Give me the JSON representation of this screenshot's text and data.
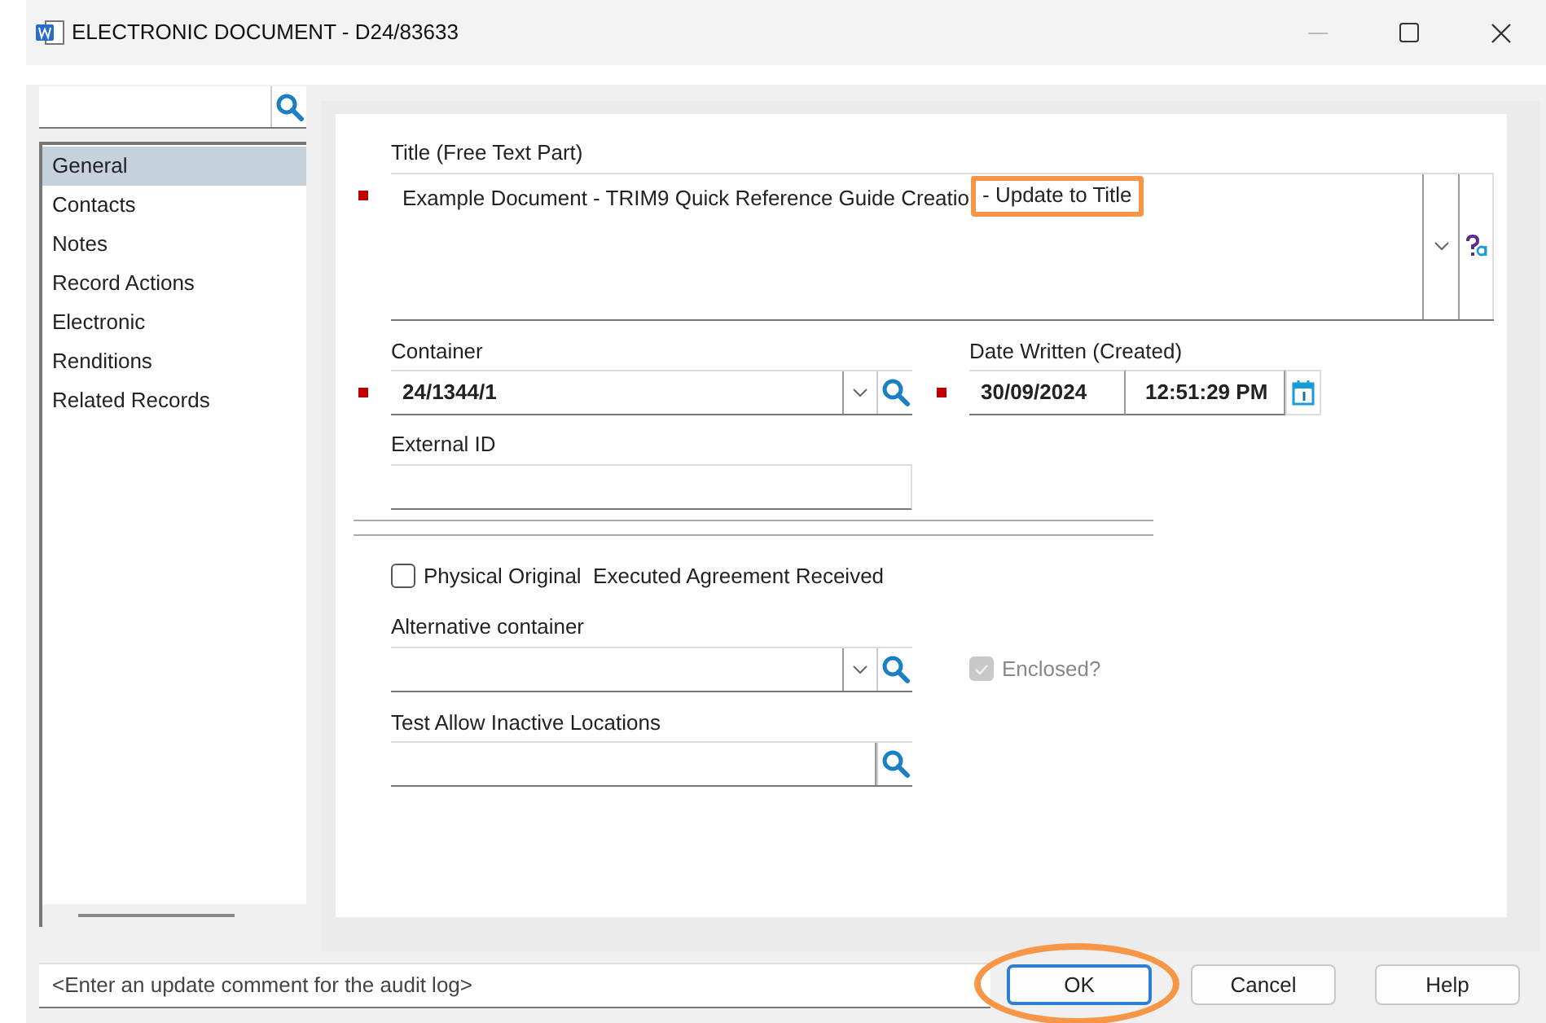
{
  "window": {
    "title": "ELECTRONIC DOCUMENT - D24/83633"
  },
  "sidebar": {
    "items": [
      {
        "label": "General",
        "selected": true
      },
      {
        "label": "Contacts",
        "selected": false
      },
      {
        "label": "Notes",
        "selected": false
      },
      {
        "label": "Record Actions",
        "selected": false
      },
      {
        "label": "Electronic",
        "selected": false
      },
      {
        "label": "Renditions",
        "selected": false
      },
      {
        "label": "Related Records",
        "selected": false
      }
    ]
  },
  "form": {
    "title": {
      "label": "Title (Free Text Part)",
      "value": "Example Document - TRIM9 Quick Reference Guide Creatio",
      "highlighted_value": "- Update to Title",
      "required": true
    },
    "container": {
      "label": "Container",
      "value": "24/1344/1",
      "required": true
    },
    "date_written": {
      "label": "Date Written (Created)",
      "date": "30/09/2024",
      "time": "12:51:29 PM",
      "required": true
    },
    "external_id": {
      "label": "External ID"
    },
    "physical_original": {
      "label": "Physical Original  Executed Agreement Received",
      "checked": false
    },
    "alternative_container": {
      "label": "Alternative container"
    },
    "enclosed": {
      "label": "Enclosed?",
      "checked": true,
      "disabled": true
    },
    "test_allow_inactive_locations": {
      "label": "Test Allow Inactive Locations"
    }
  },
  "footer": {
    "comment": {
      "placeholder": "<Enter an update comment for the audit log>"
    },
    "buttons": [
      {
        "label": "OK",
        "focused": true,
        "circled": true
      },
      {
        "label": "Cancel",
        "focused": false,
        "circled": false
      },
      {
        "label": "Help",
        "focused": false,
        "circled": false
      }
    ]
  }
}
